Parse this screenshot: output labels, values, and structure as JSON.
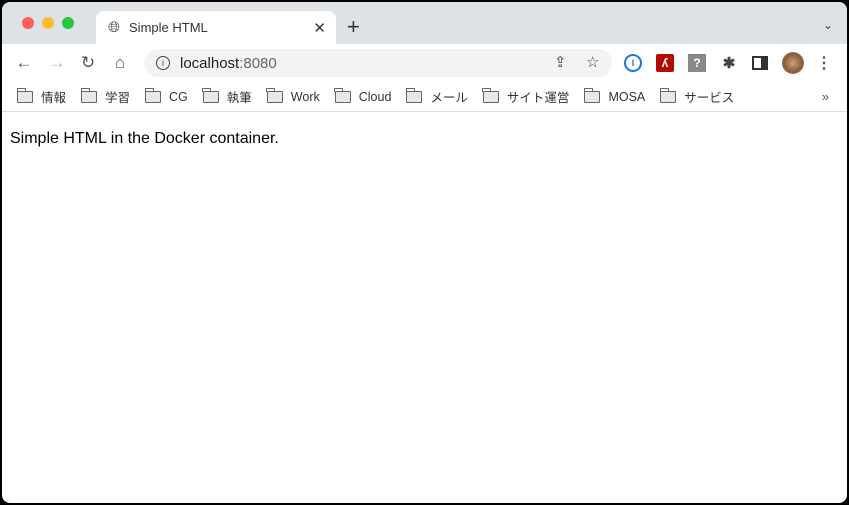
{
  "tab": {
    "title": "Simple HTML",
    "icon": "globe-icon"
  },
  "address": {
    "host": "localhost",
    "port": ":8080"
  },
  "bookmarks": [
    "情報",
    "学習",
    "CG",
    "執筆",
    "Work",
    "Cloud",
    "メール",
    "サイト運営",
    "MOSA",
    "サービス"
  ],
  "page": {
    "text": "Simple HTML in the Docker container."
  },
  "colors": {
    "close": "#ff5f57",
    "minimize": "#febc2e",
    "zoom": "#28c840",
    "tabstrip": "#dee1e6",
    "pdf": "#b30b00"
  }
}
